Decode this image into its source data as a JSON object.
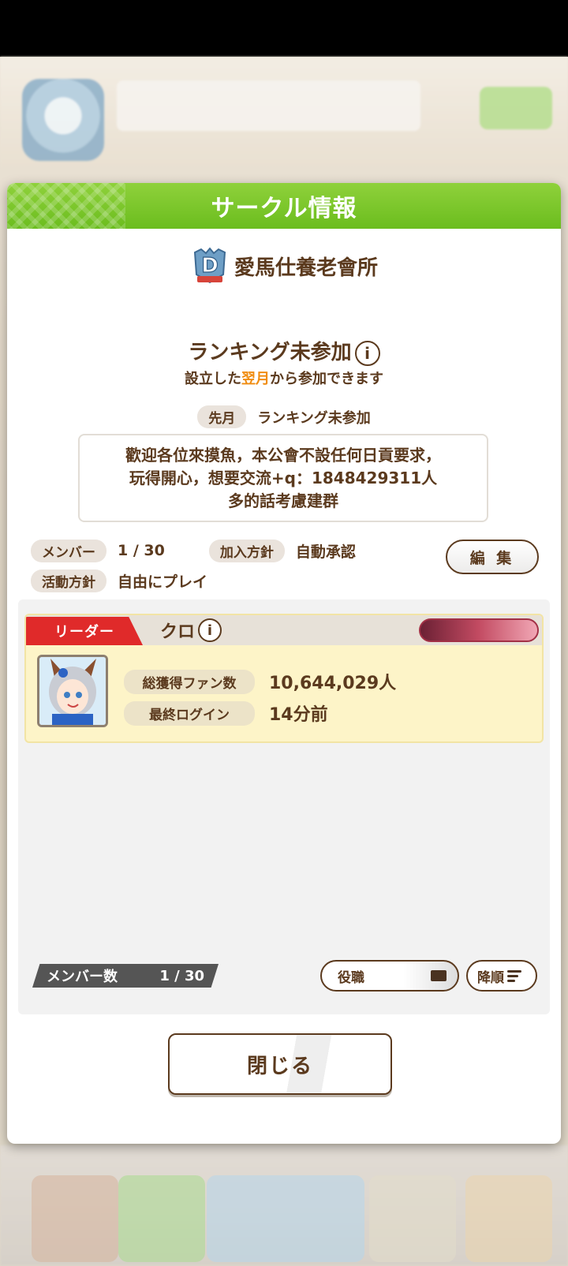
{
  "dialog": {
    "title": "サークル情報",
    "circle_name": "愛馬仕養老會所",
    "emblem_letter": "D",
    "ranking": {
      "title": "ランキング未参加",
      "info_glyph": "i",
      "sub_before": "設立した",
      "sub_highlight": "翌月",
      "sub_after": "から参加できます"
    },
    "last_month": {
      "label": "先月",
      "value": "ランキング未参加"
    },
    "description": "歡迎各位來摸魚，本公會不設任何日貢要求，\n玩得開心，想要交流+q：1848429311人\n多的話考慮建群",
    "stats": {
      "members_label": "メンバー",
      "members_value": "1 / 30",
      "join_label": "加入方針",
      "join_value": "自動承認",
      "activity_label": "活動方針",
      "activity_value": "自由にプレイ"
    },
    "edit_label": "編 集",
    "leader_card": {
      "tag": "リーダー",
      "name": "クロ",
      "fans_label": "総獲得ファン数",
      "fans_value": "10,644,029人",
      "login_label": "最終ログイン",
      "login_value": "14分前"
    },
    "member_count": {
      "label": "メンバー数",
      "value": "1 / 30"
    },
    "role_button": "役職",
    "sort_button": "降順",
    "close_button": "閉じる"
  },
  "colors": {
    "header_green": "#79c52a",
    "text_brown": "#5b3a1e",
    "highlight_orange": "#f08c10",
    "leader_red": "#e02a2a",
    "card_yellow": "#fdf4c8"
  }
}
